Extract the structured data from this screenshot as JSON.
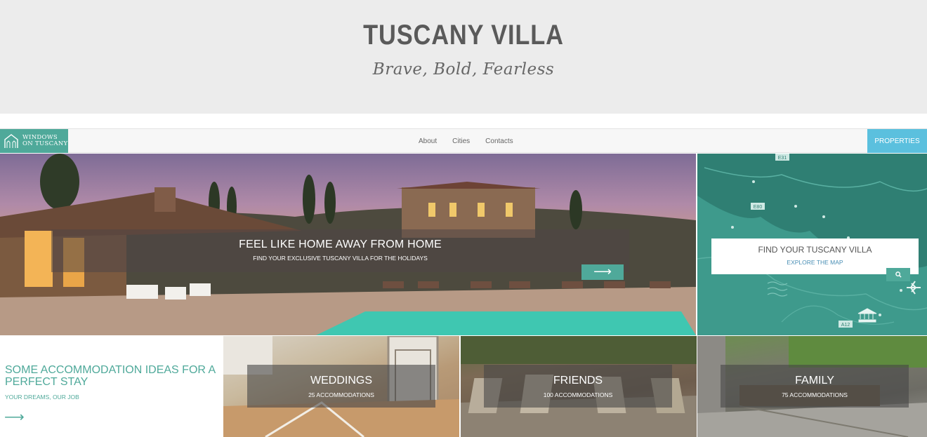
{
  "header": {
    "title": "TUSCANY VILLA",
    "tagline": "Brave, Bold, Fearless"
  },
  "navbar": {
    "logo_line1": "WINDOWS",
    "logo_line2": "ON TUSCANY",
    "links": [
      "About",
      "Cities",
      "Contacts"
    ],
    "properties_label": "PROPERTIES"
  },
  "hero": {
    "title": "FEEL LIKE HOME AWAY FROM HOME",
    "subtitle": "FIND YOUR EXCLUSIVE TUSCANY VILLA FOR THE HOLIDAYS",
    "arrow": "⟶"
  },
  "map": {
    "title": "FIND YOUR TUSCANY VILLA",
    "link": "EXPLORE THE MAP",
    "road_labels": [
      "E31",
      "E80",
      "A12"
    ]
  },
  "ideas": {
    "title": "SOME ACCOMMODATION IDEAS FOR A PERFECT STAY",
    "subtitle": "YOUR DREAMS, OUR JOB",
    "arrow": "⟶"
  },
  "tiles": [
    {
      "title": "WEDDINGS",
      "subtitle": "25 ACCOMMODATIONS"
    },
    {
      "title": "FRIENDS",
      "subtitle": "100 ACCOMMODATIONS"
    },
    {
      "title": "FAMILY",
      "subtitle": "75 ACCOMMODATIONS"
    }
  ],
  "colors": {
    "accent": "#4fa99a",
    "properties_button": "#5bc0de",
    "banner_bg": "#ececec"
  }
}
